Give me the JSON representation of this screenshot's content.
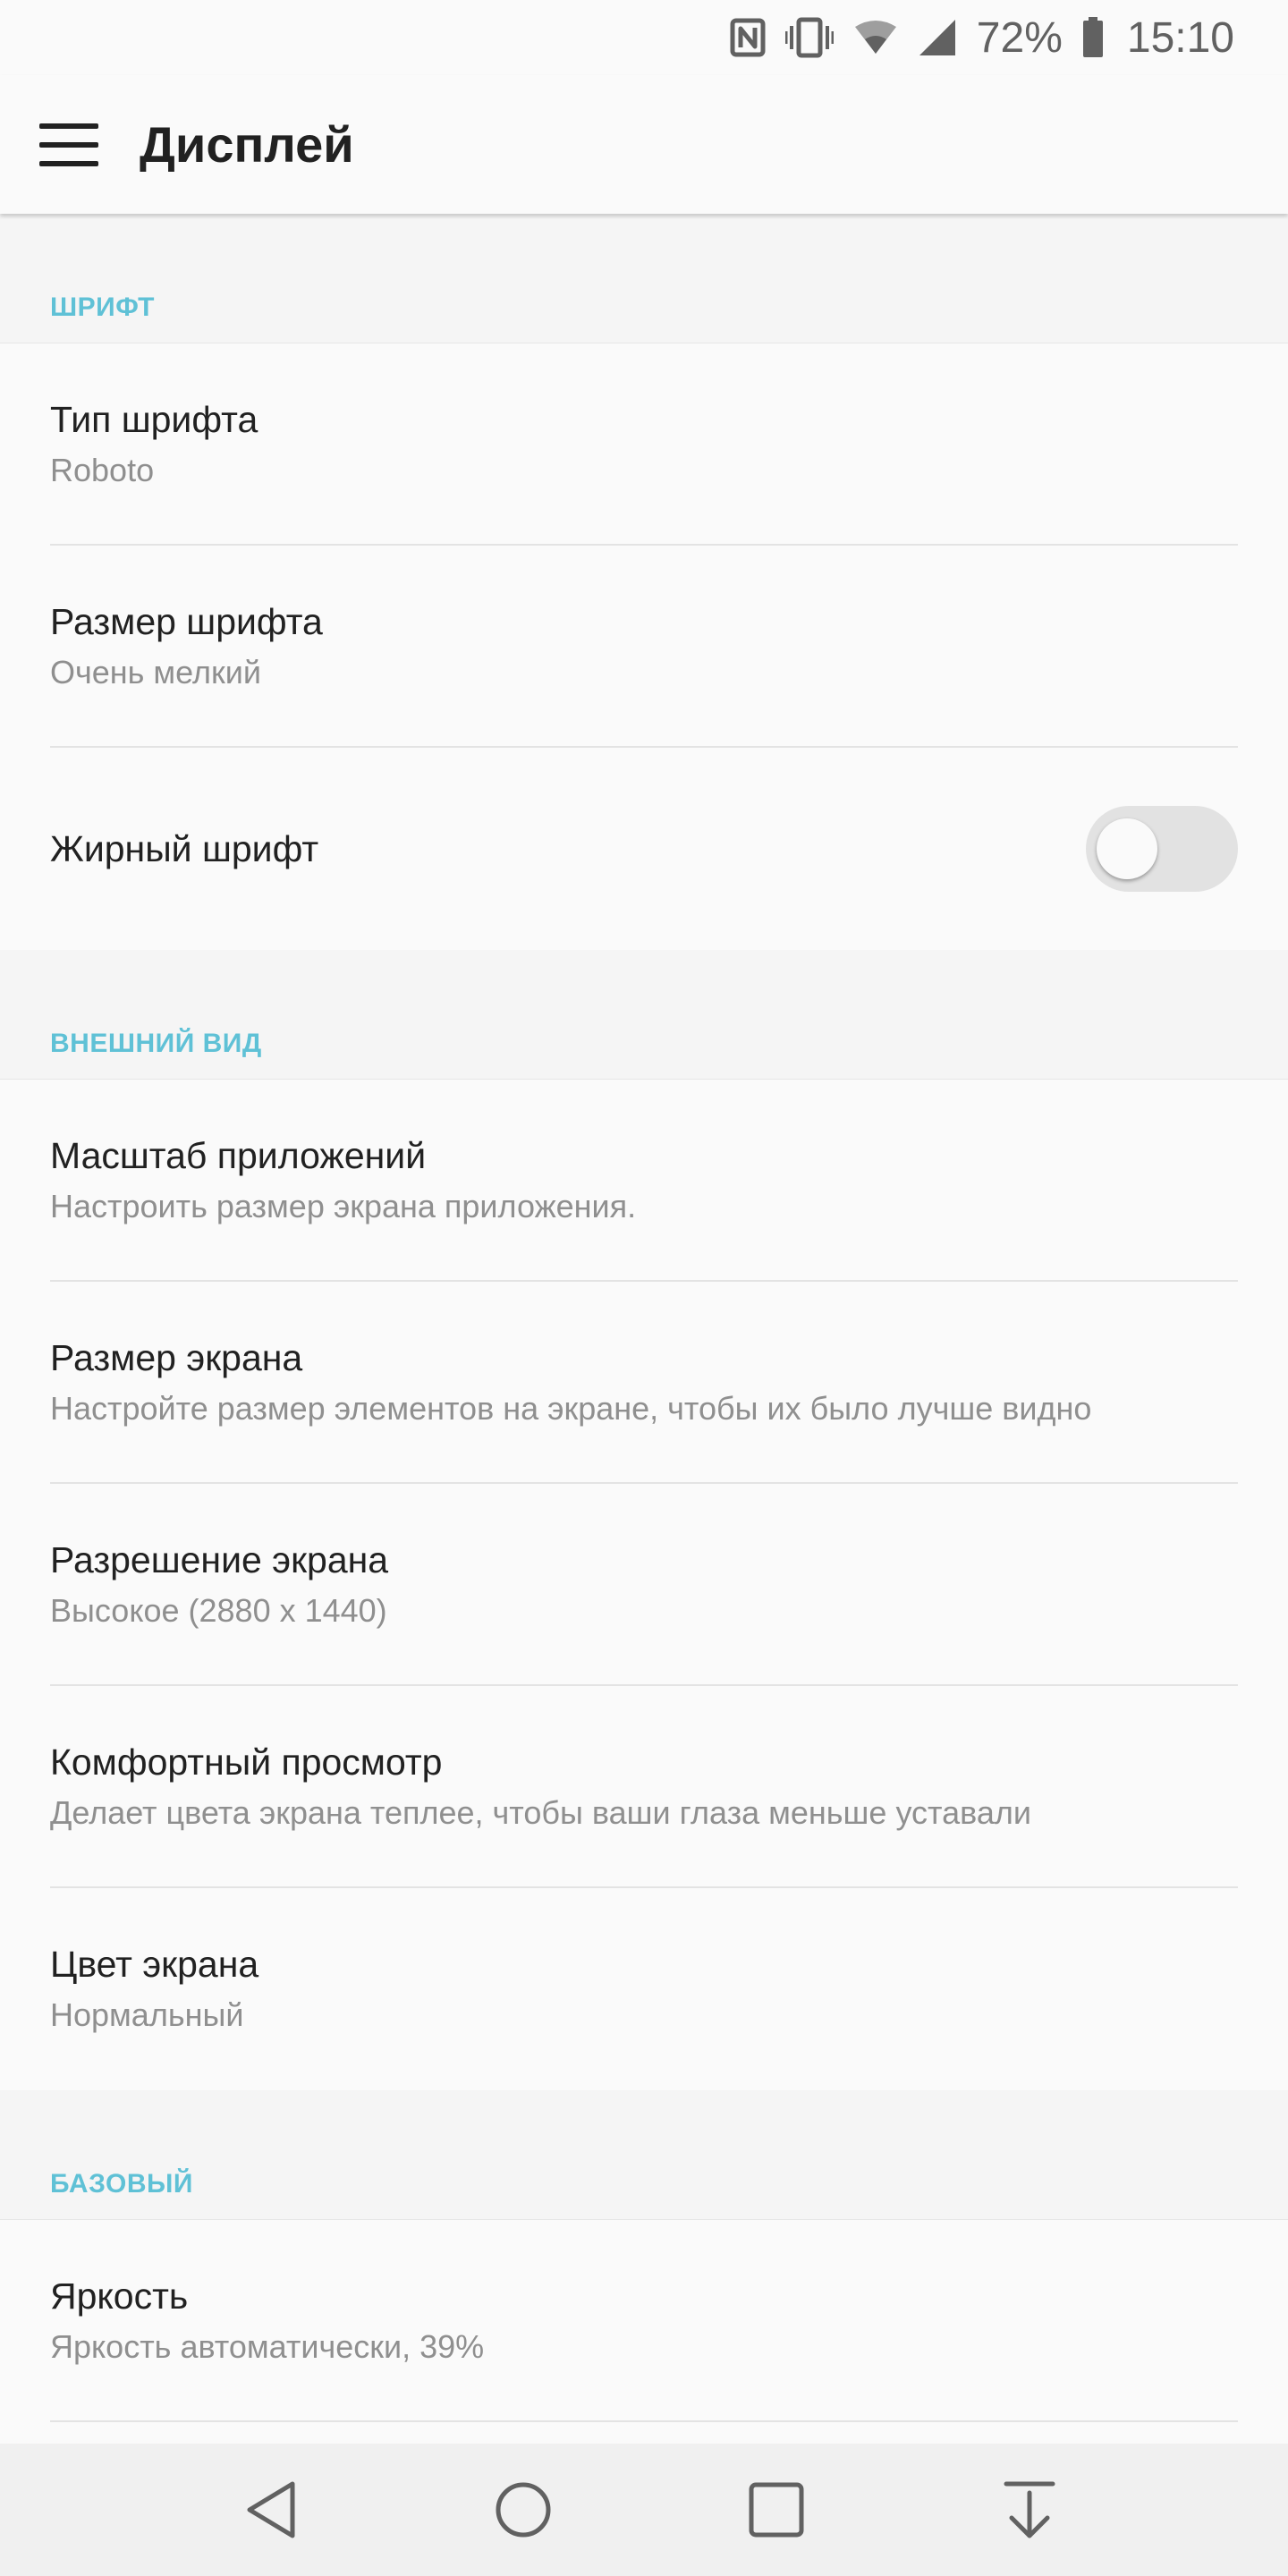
{
  "status_bar": {
    "battery_percent": "72%",
    "time": "15:10",
    "icons": [
      "nfc-icon",
      "vibrate-icon",
      "wifi-icon",
      "cell-signal-icon",
      "battery-icon"
    ]
  },
  "app_bar": {
    "title": "Дисплей",
    "menu_icon": "hamburger-menu-icon"
  },
  "accent_color": "#5fc1d6",
  "sections": {
    "font": {
      "header": "ШРИФТ",
      "items": [
        {
          "title": "Тип шрифта",
          "subtitle": "Roboto"
        },
        {
          "title": "Размер шрифта",
          "subtitle": "Очень мелкий"
        },
        {
          "title": "Жирный шрифт",
          "toggle_on": false
        }
      ]
    },
    "appearance": {
      "header": "ВНЕШНИЙ ВИД",
      "items": [
        {
          "title": "Масштаб приложений",
          "subtitle": "Настроить размер экрана приложения."
        },
        {
          "title": "Размер экрана",
          "subtitle": "Настройте размер элементов на экране, чтобы их было лучше видно"
        },
        {
          "title": "Разрешение экрана",
          "subtitle": "Высокое (2880 x 1440)"
        },
        {
          "title": "Комфортный просмотр",
          "subtitle": "Делает цвета экрана теплее, чтобы ваши глаза меньше уставали"
        },
        {
          "title": "Цвет экрана",
          "subtitle": "Нормальный"
        }
      ]
    },
    "basic": {
      "header": "БАЗОВЫЙ",
      "items": [
        {
          "title": "Яркость",
          "subtitle": "Яркость автоматически, 39%"
        }
      ]
    }
  },
  "nav_bar": {
    "buttons": [
      "back-icon",
      "home-icon",
      "recents-icon",
      "notification-pull-icon"
    ]
  }
}
